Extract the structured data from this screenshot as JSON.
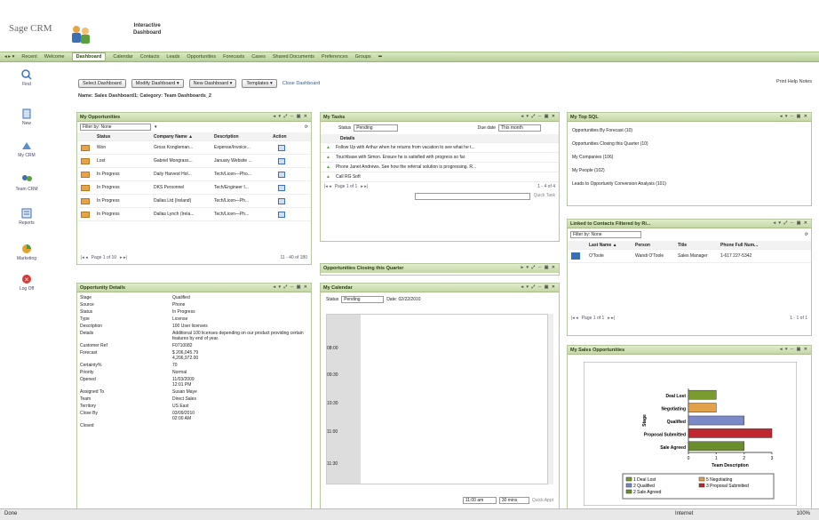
{
  "app": {
    "brand": "Sage CRM",
    "heading_line1": "Interactive",
    "heading_line2": "Dashboard"
  },
  "nav": {
    "items": [
      "Recent",
      "Welcome",
      "Dashboard",
      "Calendar",
      "Contacts",
      "Leads",
      "Opportunities",
      "Forecasts",
      "Cases",
      "Shared Documents",
      "Preferences",
      "Groups"
    ],
    "active_index": 2
  },
  "sidebar": {
    "items": [
      "Find",
      "New",
      "My CRM",
      "Team CRM",
      "Reports",
      "Marketing",
      "Log Off"
    ]
  },
  "toolbar": {
    "select_label": "Select Dashboard",
    "modify_label": "Modify Dashboard ▾",
    "new_label": "New Dashboard ▾",
    "templates_label": "Templates ▾",
    "close_label": "Close Dashboard"
  },
  "toplinks": {
    "text": "Print   Help   Notes"
  },
  "dashboard_name": "Name: Sales Dashboard1; Category: Team Dashboards_2",
  "my_opportunities": {
    "title": "My Opportunities",
    "filter_label": "Filter by: None",
    "headers": [
      "Status",
      "Company Name ▲",
      "Description",
      "Action"
    ],
    "rows": [
      {
        "status": "Won",
        "company": "Gross Kongleman...",
        "desc": "Expense/Invoice..."
      },
      {
        "status": "Lost",
        "company": "Gabriel Mongrass...",
        "desc": "January Website ..."
      },
      {
        "status": "In Progress",
        "company": "Daily Harvest Hol...",
        "desc": "Tech/Licen—Pho..."
      },
      {
        "status": "In Progress",
        "company": "DKS Personnel",
        "desc": "Tech/Engineer I..."
      },
      {
        "status": "In Progress",
        "company": "Dallas Ltd (Ireland)",
        "desc": "Tech/Licen—Ph..."
      },
      {
        "status": "In Progress",
        "company": "Dallas Lynch (Irela...",
        "desc": "Tech/Licen—Ph..."
      }
    ],
    "pager": "Page 1 of 10",
    "count": "11 - 40 of 180"
  },
  "opportunity_details": {
    "title": "Opportunity Details",
    "fields": [
      [
        "Stage",
        "Qualified"
      ],
      [
        "Source",
        "Phone"
      ],
      [
        "Status",
        "In Progress"
      ],
      [
        "Type",
        "License"
      ],
      [
        "Description",
        "100 User licenses"
      ],
      [
        "Details",
        "Additional 100 licenses depending on our product providing certain features by end of year."
      ],
      [
        "Customer Ref",
        "F0710082"
      ],
      [
        "Forecast",
        "$ 206,045.79\n4,206,972.00"
      ],
      [
        "Certainty%",
        "70"
      ],
      [
        "Priority",
        "Normal"
      ],
      [
        "Opened",
        "11/03/2009\n12:01 PM"
      ],
      [
        "Assigned To",
        "Susan Maye"
      ],
      [
        "Team",
        "Direct Sales"
      ],
      [
        "Territory",
        "US East"
      ],
      [
        "Close By",
        "03/09/2010\n02:00 AM"
      ],
      [
        "Closed",
        ""
      ]
    ]
  },
  "my_tasks": {
    "title": "My Tasks",
    "status_label": "Status",
    "status_value": "Pending",
    "due_label": "Due date",
    "due_value": "This month",
    "header": "Details",
    "rows": [
      "Follow Up with Arthur when he returns from vacation to see what he t...",
      "Touchbase with Simon. Ensure he is satisfied with progress so far.",
      "Phone Janet Andrews. See how the referral solution is progressing. R...",
      "Call RG Soft"
    ],
    "pager": "Page 1 of 1",
    "count": "1 - 4 of 4",
    "quick_text": "Quick Task"
  },
  "opp_closing": {
    "title": "Opportunities Closing this Quarter"
  },
  "my_calendar": {
    "title": "My Calendar",
    "status_label": "Status",
    "status_value": "Pending",
    "date_label": "Date: 02/22/2010",
    "times": [
      "08:00",
      "09:30",
      "10:30",
      "11:00",
      "11:30"
    ],
    "time_value": "11:00 am",
    "dur_value": "30 mins",
    "quick_label": "Quick Appt"
  },
  "top_sql": {
    "title": "My Top SQL",
    "items": [
      "Opportunities By Forecast (10)",
      "Opportunities Closing this Quarter (10)",
      "My Companies (106)",
      "My People (102)",
      "Leads to Opportunity Conversion Analysis (101)"
    ]
  },
  "linked_contacts": {
    "title": "Linked to Contacts Filtered by Ri...",
    "filter_label": "Filter by: None",
    "headers": [
      "Last Name ▲",
      "Person",
      "Title",
      "Phone Full Num..."
    ],
    "rows": [
      [
        "O'Toole",
        "Wandi O'Toole",
        "Sales Manager",
        "1-617 227-5342"
      ]
    ],
    "pager": "Page 1 of 1",
    "count": "1 - 1 of 1"
  },
  "sales_opps": {
    "title": "My Sales Opportunities",
    "chart_data": {
      "type": "bar",
      "orientation": "horizontal",
      "categories": [
        "Deal Lost",
        "Negotiating",
        "Qualified",
        "Proposal Submitted",
        "Sale Agreed"
      ],
      "values": [
        1,
        1,
        2,
        3,
        2
      ],
      "xlabel": "Team Description",
      "ylabel": "Stage",
      "xlim": [
        0,
        3
      ],
      "xticks": [
        "0",
        "1",
        "2",
        "3"
      ],
      "colors": [
        "#7a9c2e",
        "#e2a24a",
        "#7a8ac8",
        "#c0262e",
        "#6a8f2a"
      ],
      "legend": [
        "1 Deal Lost",
        "5 Negotiating",
        "2 Qualified",
        "3 Proposal Submitted",
        "2 Sale Agreed"
      ]
    }
  },
  "status": {
    "left": "Done",
    "zone": "Internet",
    "zoom": "100%"
  }
}
